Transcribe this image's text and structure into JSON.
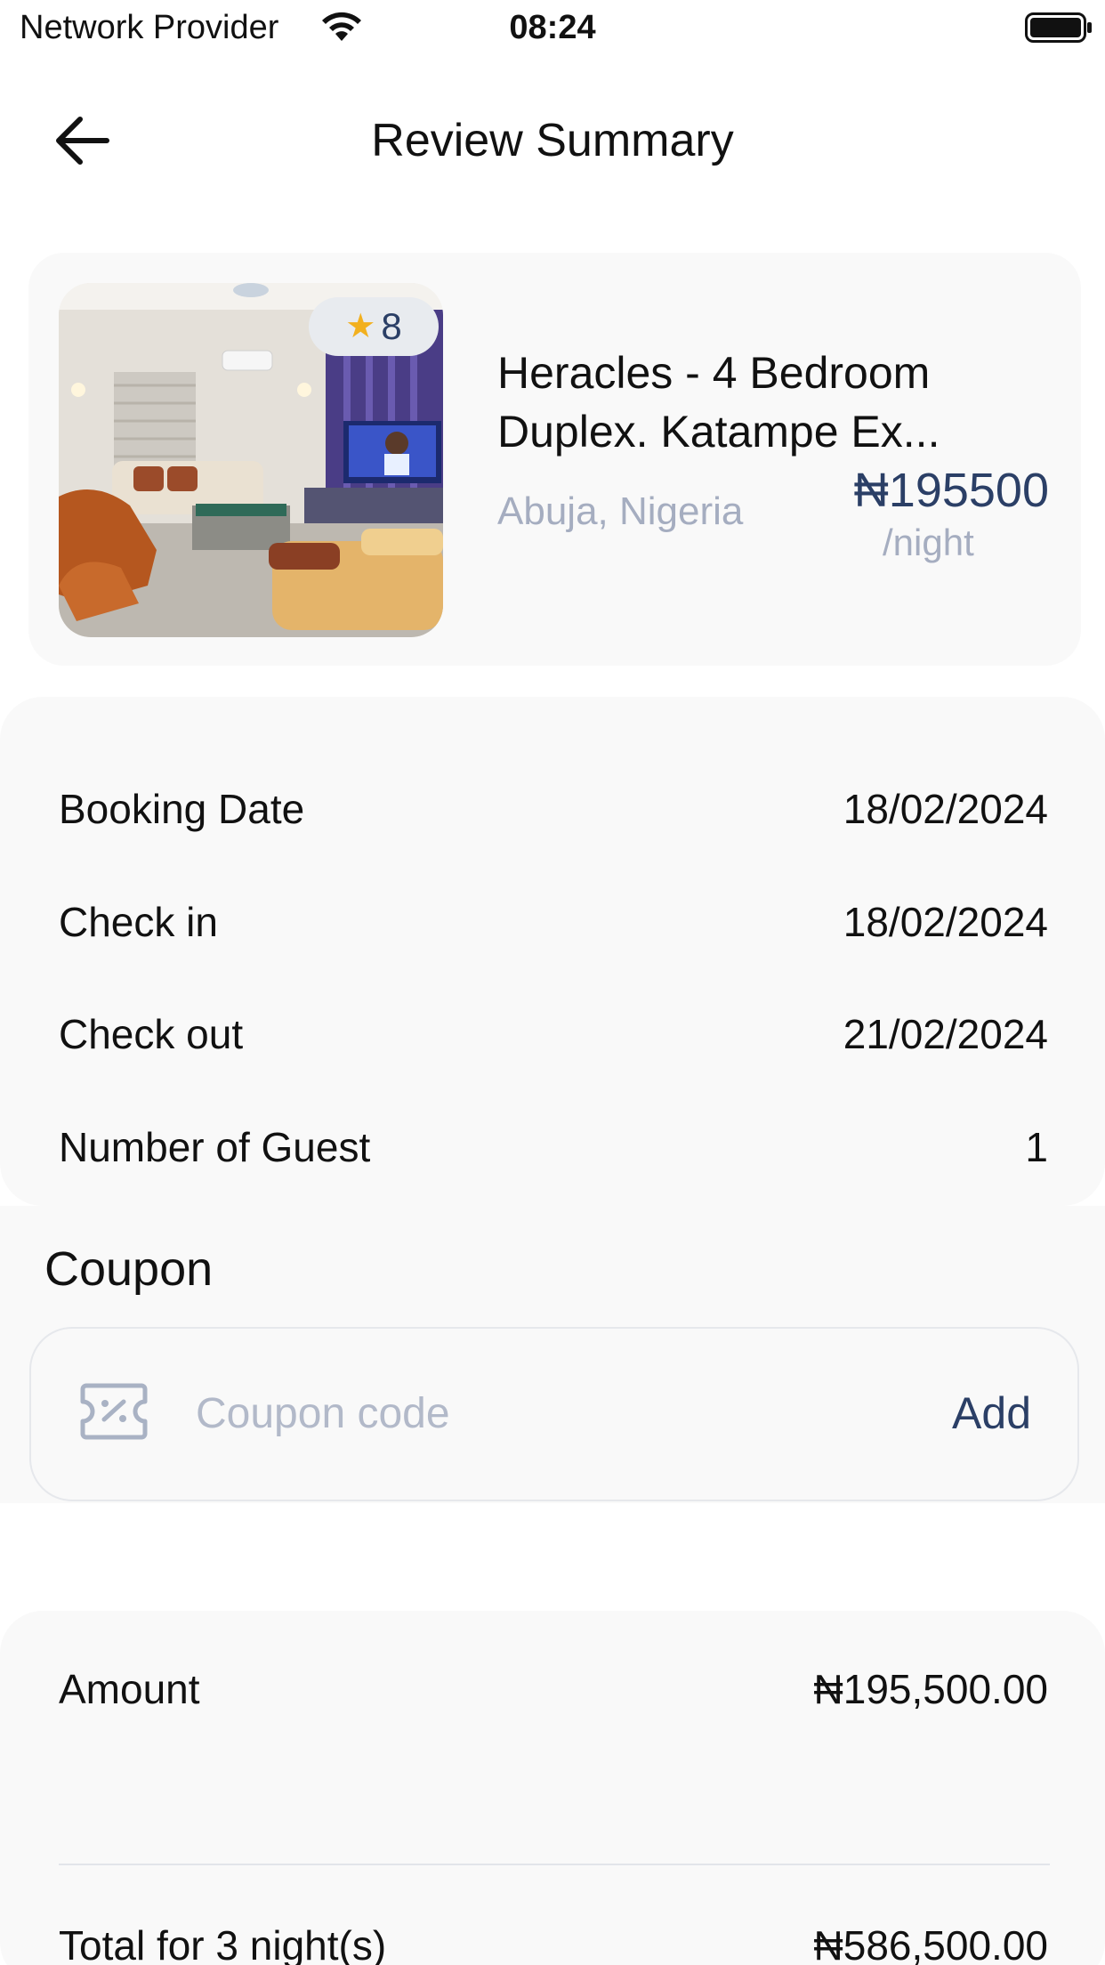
{
  "status_bar": {
    "carrier": "Network Provider",
    "time": "08:24",
    "icons": [
      "wifi-icon",
      "battery-icon"
    ]
  },
  "header": {
    "back_icon": "arrow-left-icon",
    "title": "Review Summary"
  },
  "listing": {
    "rating": "8",
    "rating_icon": "star-icon",
    "title": "Heracles - 4 Bedroom Duplex. Katampe Ex...",
    "location": "Abuja, Nigeria",
    "price": "₦195500",
    "per": "/night"
  },
  "details": [
    {
      "label": "Booking Date",
      "value": "18/02/2024"
    },
    {
      "label": "Check in",
      "value": "18/02/2024"
    },
    {
      "label": "Check out",
      "value": "21/02/2024"
    },
    {
      "label": "Number of Guest",
      "value": "1"
    }
  ],
  "coupon": {
    "heading": "Coupon",
    "placeholder": "Coupon code",
    "value": "",
    "add_label": "Add",
    "icon": "coupon-ticket-icon"
  },
  "summary": {
    "amount_label": "Amount",
    "amount_value": "₦195,500.00",
    "total_label": "Total for 3 night(s)",
    "total_value": "₦586,500.00"
  },
  "colors": {
    "accent": "#2b3f66",
    "muted": "#a5adc0",
    "star": "#f2b01e",
    "card_bg": "#f9f9f9"
  }
}
